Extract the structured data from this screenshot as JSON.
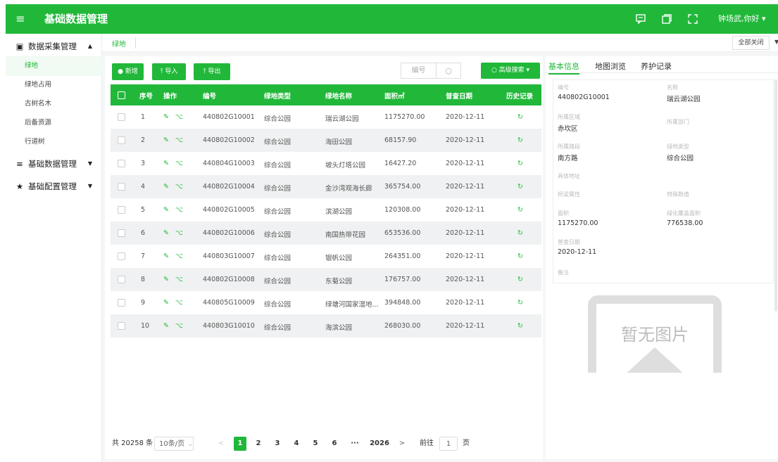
{
  "app": {
    "title": "基础数据管理",
    "user": "钟场武,你好 ▾"
  },
  "sidebar": {
    "groups": [
      {
        "label": "数据采集管理",
        "caret": "▲"
      },
      {
        "label": "基础数据管理",
        "caret": "▼"
      },
      {
        "label": "基础配置管理",
        "caret": "▼"
      }
    ],
    "items": [
      "绿地",
      "绿地占用",
      "古树名木",
      "后备资源",
      "行道树"
    ]
  },
  "tabs": {
    "active": "绿地",
    "close_all": "全部关闭"
  },
  "toolbar": {
    "add": "● 新增",
    "import": "⤒ 导入",
    "export": "⤒ 导出",
    "search_placeholder": "编号",
    "advanced": "○ 高级搜索 ▾"
  },
  "table": {
    "headers": [
      "序号",
      "操作",
      "编号",
      "绿地类型",
      "绿地名称",
      "面积㎡",
      "普查日期",
      "历史记录"
    ],
    "rows": [
      [
        "1",
        "440802G10001",
        "综合公园",
        "瑞云湖公园",
        "1175270.00",
        "2020-12-11"
      ],
      [
        "2",
        "440802G10002",
        "综合公园",
        "海田公园",
        "68157.90",
        "2020-12-11"
      ],
      [
        "3",
        "440804G10003",
        "综合公园",
        "坡头灯塔公园",
        "16427.20",
        "2020-12-11"
      ],
      [
        "4",
        "440802G10004",
        "综合公园",
        "金沙湾观海长廊",
        "365754.00",
        "2020-12-11"
      ],
      [
        "5",
        "440802G10005",
        "综合公园",
        "滨湖公园",
        "120308.00",
        "2020-12-11"
      ],
      [
        "6",
        "440802G10006",
        "综合公园",
        "南国热带花园",
        "653536.00",
        "2020-12-11"
      ],
      [
        "7",
        "440803G10007",
        "综合公园",
        "银帆公园",
        "264351.00",
        "2020-12-11"
      ],
      [
        "8",
        "440802G10008",
        "综合公园",
        "东菊公园",
        "176757.00",
        "2020-12-11"
      ],
      [
        "9",
        "440805G10009",
        "综合公园",
        "绿塘河国家湿地...",
        "394848.00",
        "2020-12-11"
      ],
      [
        "10",
        "440803G10010",
        "综合公园",
        "海滨公园",
        "268030.00",
        "2020-12-11"
      ]
    ]
  },
  "pager": {
    "total": "共 20258 条",
    "page_size": "10条/页",
    "pages": [
      "1",
      "2",
      "3",
      "4",
      "5",
      "6",
      "···",
      "2026"
    ],
    "goto": "前往",
    "goto_value": "1",
    "page_unit": "页"
  },
  "detail": {
    "tabs": [
      "基本信息",
      "地图浏览",
      "养护记录"
    ],
    "fields": [
      {
        "label": "编号",
        "value": "440802G10001"
      },
      {
        "label": "名称",
        "value": "瑞云湖公园"
      },
      {
        "label": "所属区域",
        "value": "赤坎区"
      },
      {
        "label": "所属部门",
        "value": ""
      },
      {
        "label": "所属路段",
        "value": "南方路"
      },
      {
        "label": "绿地类型",
        "value": "综合公园"
      },
      {
        "label": "具体地址",
        "value": ""
      },
      {
        "label": "桥梁属性",
        "value": ""
      },
      {
        "label": "特殊数值",
        "value": ""
      },
      {
        "label": "面积",
        "value": "1175270.00"
      },
      {
        "label": "绿化覆盖面积",
        "value": "776538.00"
      },
      {
        "label": "普查日期",
        "value": "2020-12-11"
      },
      {
        "label": "备注",
        "value": ""
      }
    ],
    "no_image": "暂无图片"
  },
  "colors": {
    "accent": "#21b83a"
  }
}
